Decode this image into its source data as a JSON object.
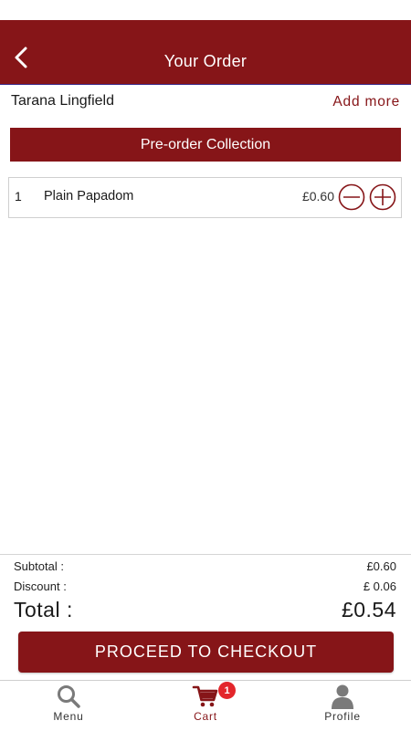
{
  "header": {
    "title": "Your Order",
    "back_icon": "chevron-left-icon"
  },
  "order": {
    "restaurant": "Tarana Lingfield",
    "add_more_label": "Add more",
    "type_label": "Pre-order Collection",
    "items": [
      {
        "qty": "1",
        "name": "Plain Papadom",
        "price": "£0.60"
      }
    ]
  },
  "summary": {
    "subtotal_label": "Subtotal :",
    "subtotal_value": "£0.60",
    "discount_label": "Discount :",
    "discount_value": "£ 0.06",
    "total_label": "Total :",
    "total_value": "£0.54"
  },
  "checkout_label": "PROCEED TO CHECKOUT",
  "tabbar": {
    "tabs": [
      {
        "label": "Menu",
        "icon": "search-icon"
      },
      {
        "label": "Cart",
        "icon": "cart-icon",
        "badge": "1"
      },
      {
        "label": "Profile",
        "icon": "user-icon"
      }
    ]
  },
  "colors": {
    "brand": "#861518",
    "badge": "#e3262b"
  }
}
